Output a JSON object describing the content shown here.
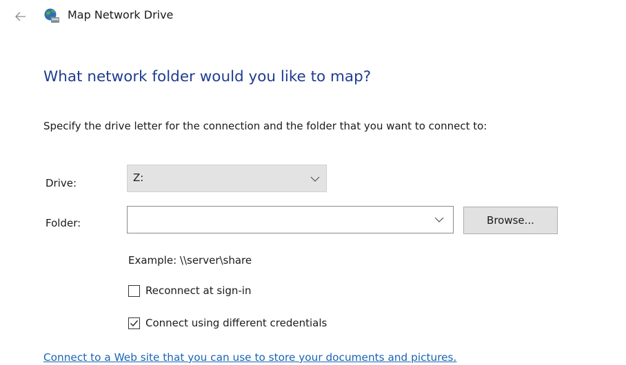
{
  "window": {
    "title": "Map Network Drive",
    "back_icon": "back-arrow-icon",
    "app_icon": "network-drive-icon"
  },
  "main": {
    "heading": "What network folder would you like to map?",
    "instructions": "Specify the drive letter for the connection and the folder that you want to connect to:"
  },
  "form": {
    "drive_label": "Drive:",
    "drive_value": "Z:",
    "folder_label": "Folder:",
    "folder_value": "",
    "folder_placeholder": "",
    "browse_label": "Browse...",
    "example_text": "Example: \\\\server\\share",
    "reconnect_label": "Reconnect at sign-in",
    "reconnect_checked": false,
    "credentials_label": "Connect using different credentials",
    "credentials_checked": true,
    "web_link": "Connect to a Web site that you can use to store your documents and pictures."
  },
  "colors": {
    "heading": "#1e3d8f",
    "link": "#1a64b4",
    "select_bg": "#e3e3e3",
    "button_bg": "#e1e1e1"
  }
}
